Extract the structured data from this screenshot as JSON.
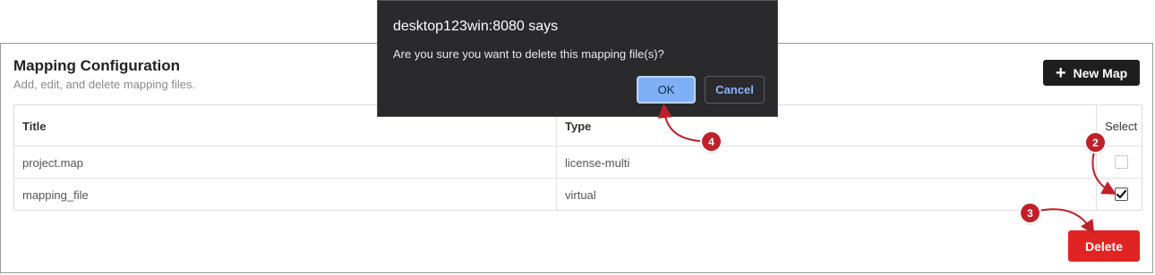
{
  "page": {
    "title": "Mapping Configuration",
    "subtitle": "Add, edit, and delete mapping files.",
    "new_map_label": "New Map",
    "delete_label": "Delete"
  },
  "table": {
    "headers": {
      "title": "Title",
      "type": "Type",
      "select": "Select"
    },
    "rows": [
      {
        "title": "project.map",
        "type": "license-multi",
        "selected": false
      },
      {
        "title": "mapping_file",
        "type": "virtual",
        "selected": true
      }
    ]
  },
  "dialog": {
    "title": "desktop123win:8080 says",
    "message": "Are you sure you want to delete this mapping file(s)?",
    "ok_label": "OK",
    "cancel_label": "Cancel"
  },
  "callouts": {
    "step2": "2",
    "step3": "3",
    "step4": "4"
  },
  "colors": {
    "accent_dark": "#1e1e1e",
    "delete_red": "#e02424",
    "callout_red": "#c0202a",
    "dialog_bg": "#2a2a2d",
    "ok_blue": "#7fb0f5"
  },
  "icons": {
    "new_map": "plus-icon",
    "checked": "checkmark-icon"
  }
}
